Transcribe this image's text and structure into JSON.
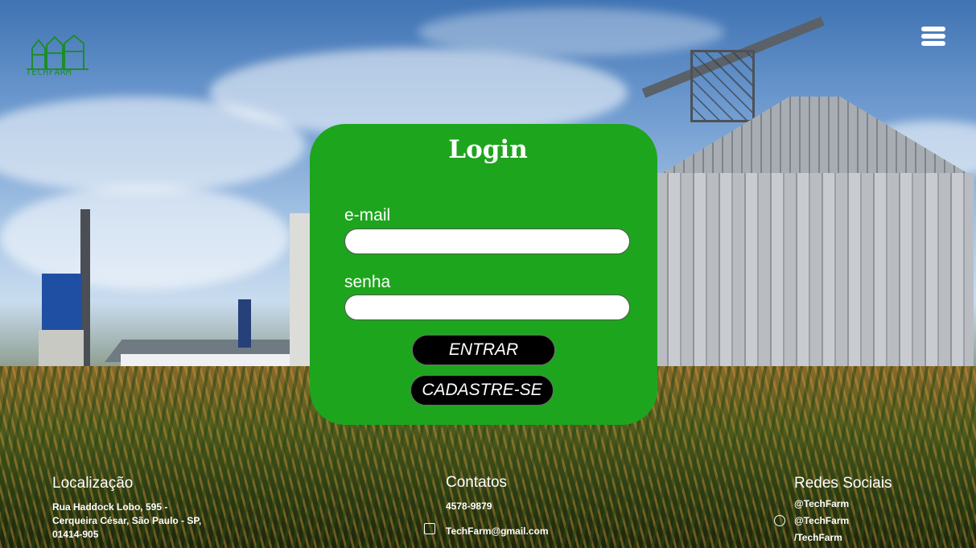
{
  "header": {
    "logo_text": "TECHFARM",
    "menu_icon": "hamburger-menu-icon"
  },
  "login": {
    "title": "Login",
    "email_label": "e-mail",
    "email_value": "",
    "password_label": "senha",
    "password_value": "",
    "submit_label": "ENTRAR",
    "signup_label": "CADASTRE-SE"
  },
  "footer": {
    "location": {
      "title": "Localização",
      "lines": [
        "Rua Haddock Lobo, 595 -",
        "Cerqueira César, São Paulo - SP,",
        "01414-905"
      ]
    },
    "contacts": {
      "title": "Contatos",
      "phone": "4578-9879",
      "email": "TechFarm@gmail.com"
    },
    "social": {
      "title": "Redes Sociais",
      "handles": [
        "@TechFarm",
        "@TechFarm",
        "/TechFarm"
      ]
    }
  },
  "colors": {
    "card_green": "#1ea51e",
    "logo_green": "#1d8d2a",
    "button_black": "#000000",
    "text_white": "#ffffff"
  }
}
